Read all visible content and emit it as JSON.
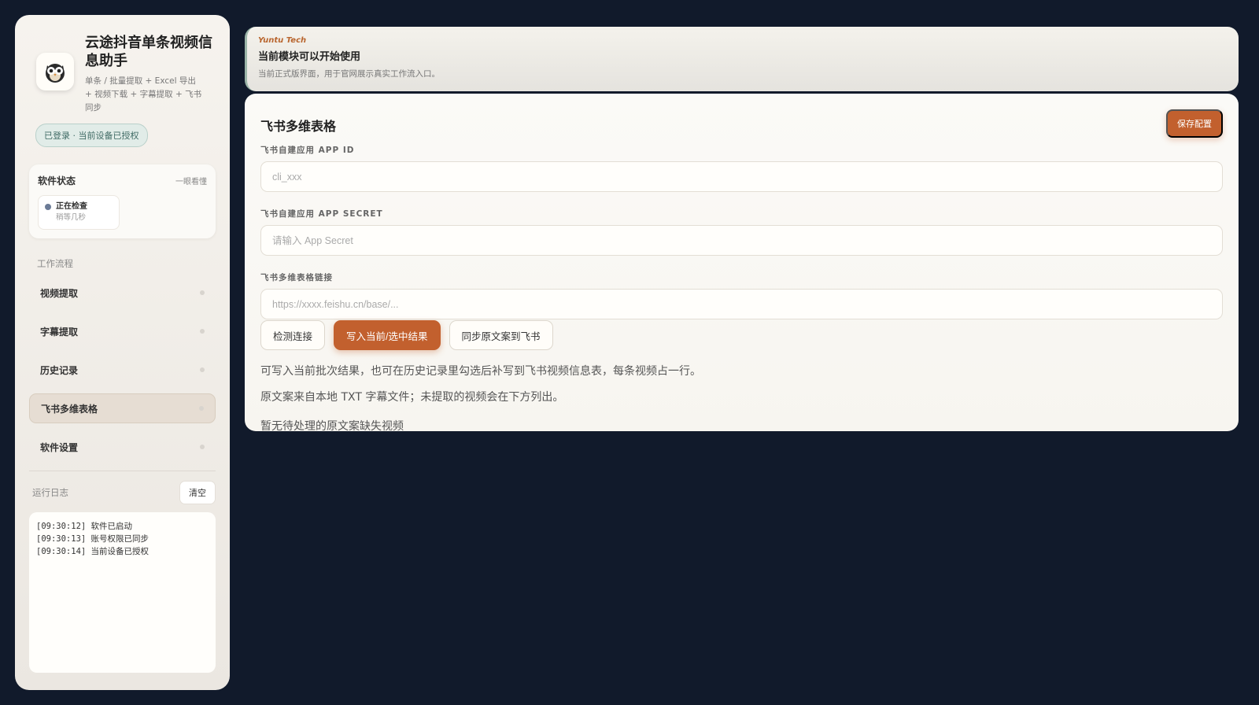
{
  "sidebar": {
    "app_title": "云途抖音单条视频信息助手",
    "app_subtitle": "单条 / 批量提取 + Excel 导出 + 视频下载 + 字幕提取 + 飞书同步",
    "auth_badge": "已登录 · 当前设备已授权",
    "status": {
      "title": "软件状态",
      "hint": "一眼看懂",
      "chip_main": "正在检查",
      "chip_sub": "稍等几秒"
    },
    "workflow_label": "工作流程",
    "nav": [
      {
        "label": "视频提取"
      },
      {
        "label": "字幕提取"
      },
      {
        "label": "历史记录"
      },
      {
        "label": "飞书多维表格"
      },
      {
        "label": "软件设置"
      }
    ],
    "log": {
      "title": "运行日志",
      "clear_label": "清空",
      "lines": [
        "[09:30:12] 软件已启动",
        "[09:30:13] 账号权限已同步",
        "[09:30:14] 当前设备已授权"
      ]
    }
  },
  "banner": {
    "brand": "Yuntu Tech",
    "title": "当前模块可以开始使用",
    "subtitle": "当前正式版界面，用于官网展示真实工作流入口。"
  },
  "main": {
    "title": "飞书多维表格",
    "save_label": "保存配置",
    "fields": [
      {
        "label": "飞书自建应用 APP ID",
        "placeholder": "cli_xxx"
      },
      {
        "label": "飞书自建应用 APP SECRET",
        "placeholder": "请输入 App Secret"
      },
      {
        "label": "飞书多维表格链接",
        "placeholder": "https://xxxx.feishu.cn/base/..."
      }
    ],
    "buttons": {
      "check": "检测连接",
      "write": "写入当前/选中结果",
      "sync": "同步原文案到飞书"
    },
    "desc_1": "可写入当前批次结果，也可在历史记录里勾选后补写到飞书视频信息表，每条视频占一行。",
    "desc_2": "原文案来自本地 TXT 字幕文件；未提取的视频会在下方列出。",
    "desc_3": "暂无待处理的原文案缺失视频"
  },
  "colors": {
    "accent": "#c2602e",
    "background": "#111a2b",
    "auth_badge": "#3f6a64"
  }
}
